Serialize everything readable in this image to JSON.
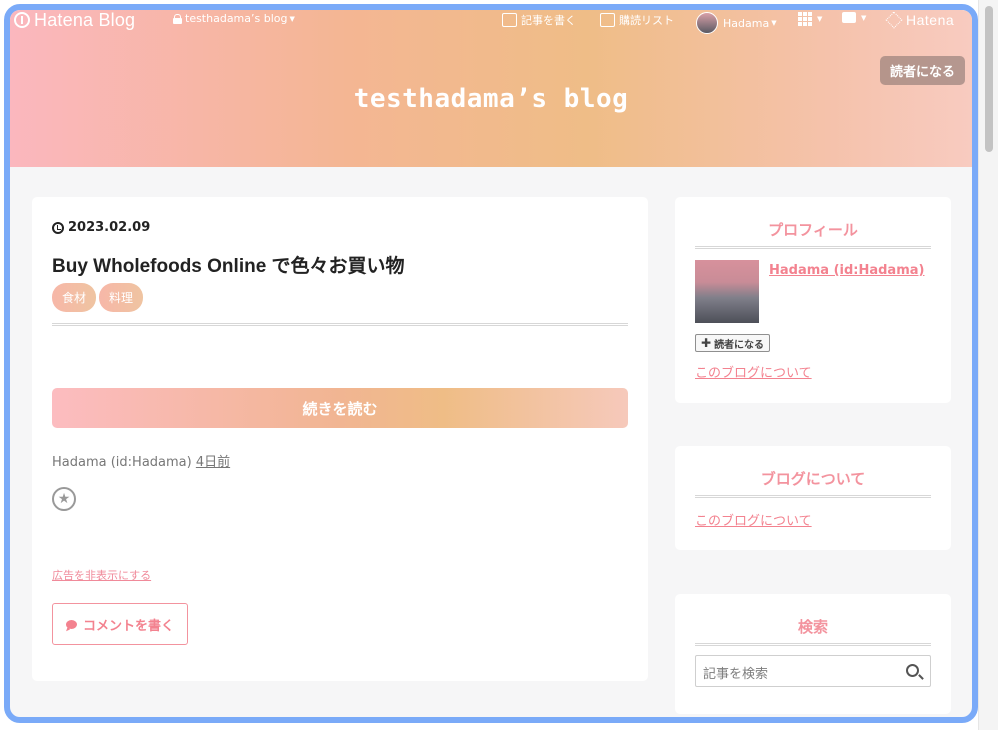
{
  "topbar": {
    "logo": "Hatena Blog",
    "blog_selector": "testhadama’s blog",
    "write_label": "記事を書く",
    "reading_list_label": "購読リスト",
    "user_label": "Hadama",
    "hatena_label": "Hatena"
  },
  "header": {
    "blog_title": "testhadama’s blog",
    "subscribe_label": "読者になる"
  },
  "article": {
    "date": "2023.02.09",
    "title": "Buy Wholefoods Online で色々お買い物",
    "tags": [
      "食材",
      "料理"
    ],
    "read_more_label": "続きを読む",
    "author": "Hadama (id:Hadama)",
    "time_ago": "4日前",
    "hide_ads_label": "広告を非表示にする",
    "comment_label": "コメントを書く"
  },
  "sidebar": {
    "profile": {
      "title": "プロフィール",
      "name": "Hadama (id:Hadama)",
      "subscribe_label": "読者になる",
      "about_link": "このブログについて"
    },
    "about": {
      "title": "ブログについて",
      "link": "このブログについて"
    },
    "search": {
      "title": "検索",
      "placeholder": "記事を検索"
    }
  },
  "colors": {
    "accent": "#f3828f",
    "window_border": "#7aaaf8"
  }
}
